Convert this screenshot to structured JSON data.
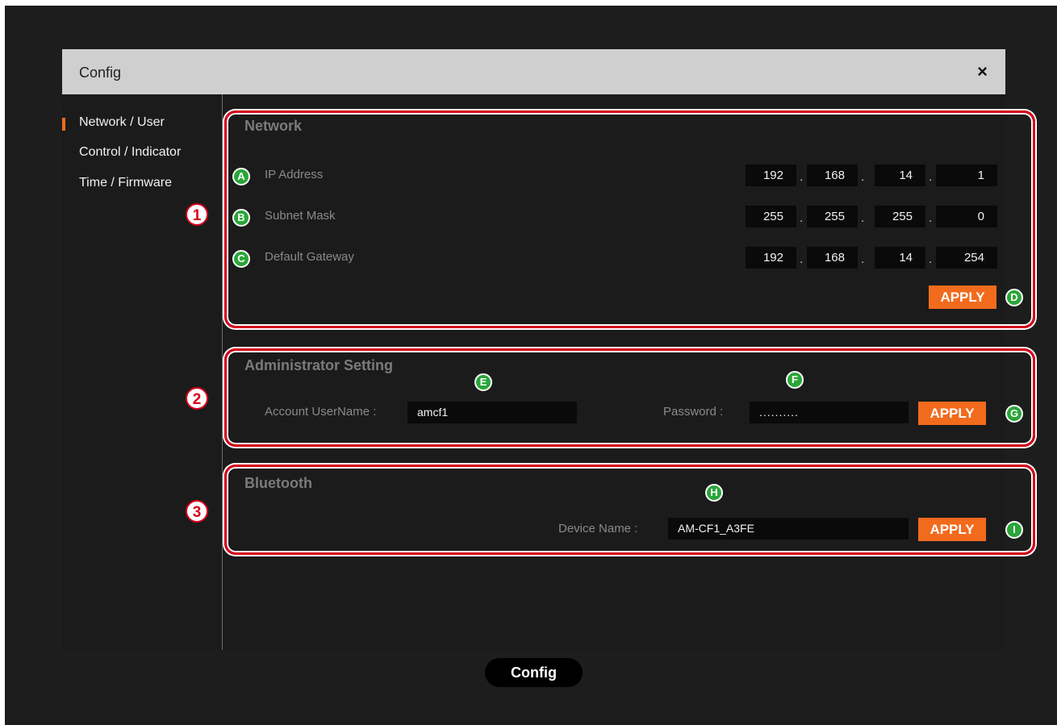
{
  "dialog": {
    "title": "Config",
    "close_symbol": "×"
  },
  "sidebar": {
    "items": [
      {
        "label": "Network / User",
        "active": true
      },
      {
        "label": "Control / Indicator",
        "active": false
      },
      {
        "label": "Time / Firmware",
        "active": false
      }
    ]
  },
  "network": {
    "title": "Network",
    "ip_address": {
      "label": "IP Address",
      "octets": [
        "192",
        "168",
        "14",
        "1"
      ]
    },
    "subnet_mask": {
      "label": "Subnet Mask",
      "octets": [
        "255",
        "255",
        "255",
        "0"
      ]
    },
    "default_gateway": {
      "label": "Default Gateway",
      "octets": [
        "192",
        "168",
        "14",
        "254"
      ]
    },
    "octet_separator": ".",
    "apply_label": "APPLY"
  },
  "admin": {
    "title": "Administrator Setting",
    "username_label": "Account UserName :",
    "username_value": "amcf1",
    "password_label": "Password :",
    "password_value": "..........",
    "apply_label": "APPLY"
  },
  "bluetooth": {
    "title": "Bluetooth",
    "device_name_label": "Device Name :",
    "device_name_value": "AM-CF1_A3FE",
    "apply_label": "APPLY"
  },
  "callouts": {
    "sections": [
      "1",
      "2",
      "3"
    ],
    "letters": [
      "A",
      "B",
      "C",
      "D",
      "E",
      "F",
      "G",
      "H",
      "I"
    ]
  },
  "bottom_tab": {
    "label": "Config"
  },
  "colors": {
    "accent": "#f26b1d",
    "callout_red": "#d6001c",
    "callout_green": "#2aa639",
    "titlebar": "#cfcfcf",
    "background": "#1b1b1b"
  }
}
